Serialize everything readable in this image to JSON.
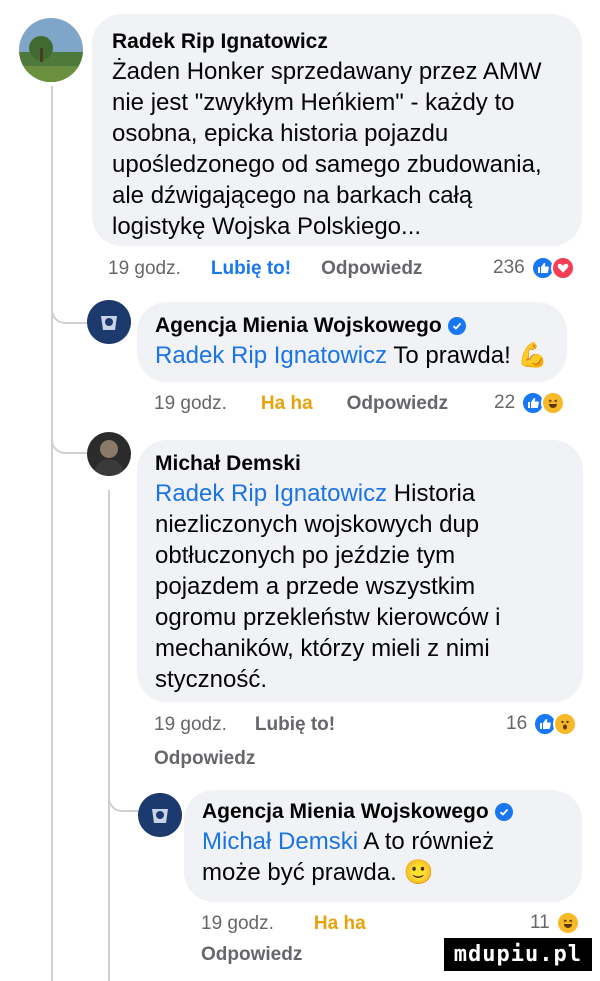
{
  "comments": [
    {
      "author": "Radek Rip Ignatowicz",
      "text": "Żaden Honker sprzedawany przez AMW nie jest \"zwykłym Heńkiem\" - każdy to osobna, epicka historia pojazdu upośledzonego od samego zbudowania, ale dźwigającego na barkach całą logistykę Wojska Polskiego...",
      "lines": [
        "Żaden Honker sprzedawany przez AMW",
        "nie jest \"zwykłym Heńkiem\" - każdy to",
        "osobna, epicka historia pojazdu",
        "upośledzonego od samego zbudowania,",
        "ale dźwigającego na barkach całą",
        "logistykę Wojska Polskiego..."
      ],
      "time": "19 godz.",
      "like_label": "Lubię to!",
      "reply_label": "Odpowiedz",
      "reaction_count": "236",
      "reactions": [
        "like",
        "love"
      ]
    },
    {
      "author": "Agencja Mienia Wojskowego",
      "verified": true,
      "mention": "Radek Rip Ignatowicz",
      "text": "To prawda!",
      "emoji": "💪",
      "time": "19 godz.",
      "like_label": "Ha ha",
      "reply_label": "Odpowiedz",
      "reaction_count": "22",
      "reactions": [
        "like",
        "haha"
      ]
    },
    {
      "author": "Michał Demski",
      "mention": "Radek Rip Ignatowicz",
      "text_first": "Historia",
      "lines": [
        "niezliczonych wojskowych dup",
        "obtłuczonych po jeździe tym",
        "pojazdem a przede wszystkim",
        "ogromu przekleństw kierowców i",
        "mechaników, którzy mieli z nimi",
        "styczność."
      ],
      "time": "19 godz.",
      "like_label": "Lubię to!",
      "reply_label": "Odpowiedz",
      "reaction_count": "16",
      "reactions": [
        "like",
        "wow"
      ]
    },
    {
      "author": "Agencja Mienia Wojskowego",
      "verified": true,
      "mention": "Michał Demski",
      "text_first": "A to również",
      "line2": "może być prawda.",
      "emoji": "🙂",
      "time": "19 godz.",
      "like_label": "Ha ha",
      "reply_label": "Odpowiedz",
      "reaction_count": "11",
      "reactions": [
        "haha"
      ]
    }
  ],
  "watermark": "mdupiu.pl",
  "colors": {
    "link": "#1877f2",
    "mention": "#1b74e4",
    "bubble": "#f0f2f5",
    "meta": "#65676b"
  }
}
